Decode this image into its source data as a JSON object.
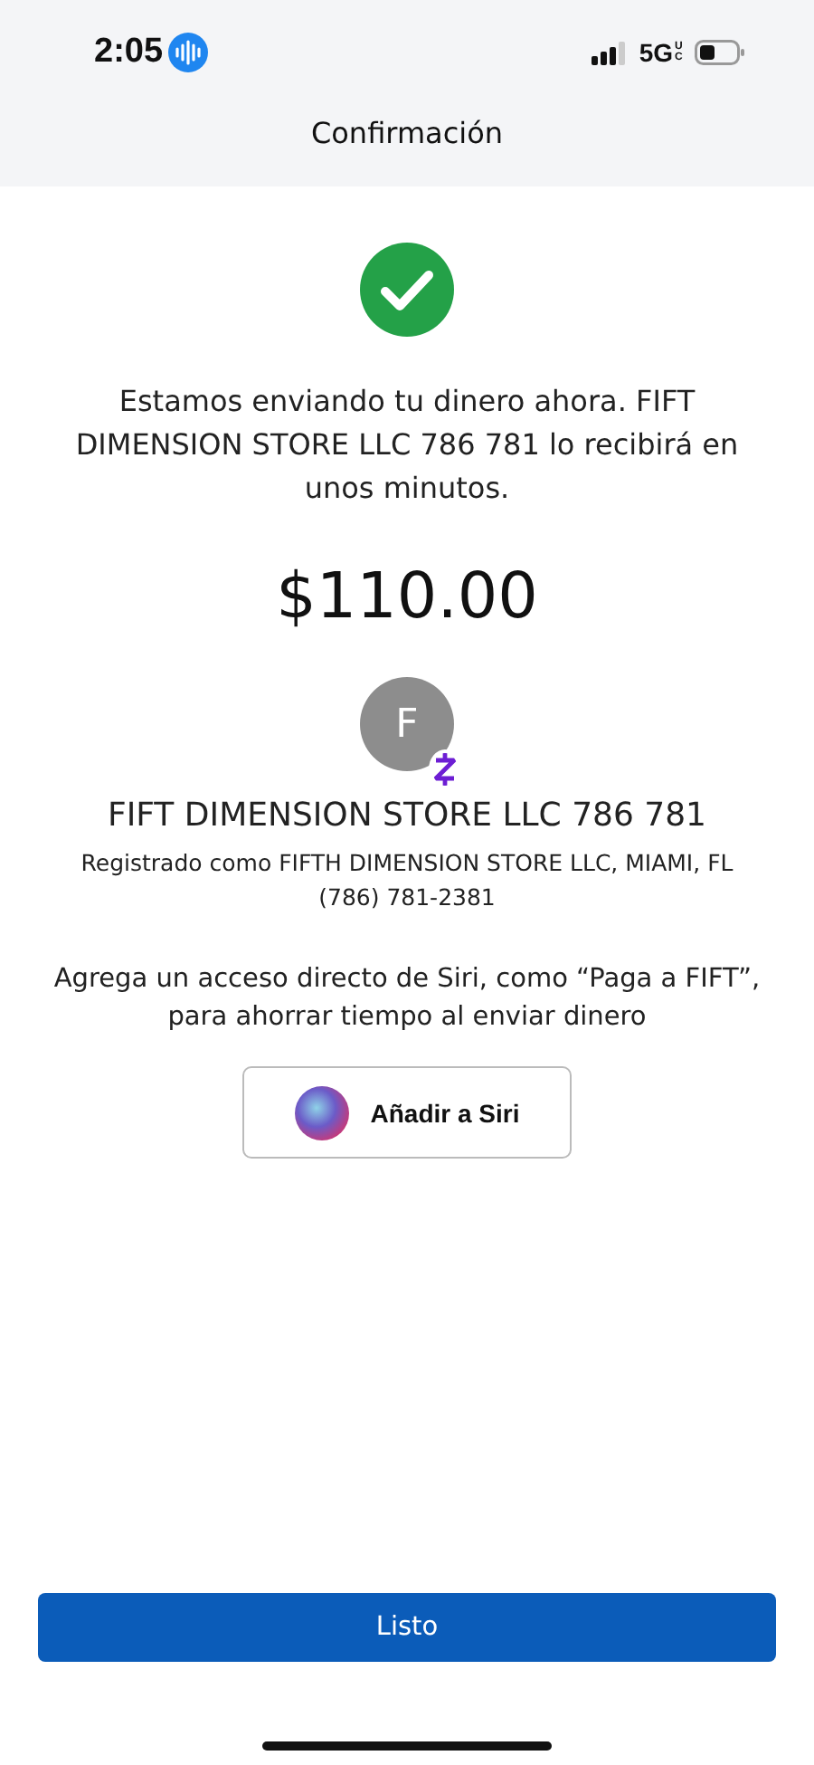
{
  "status_bar": {
    "time": "2:05",
    "network": "5G",
    "network_sub": "UC"
  },
  "header": {
    "title": "Confirmación"
  },
  "message": "Estamos enviando tu dinero ahora. FIFT DIMENSION STORE LLC 786 781 lo recibirá en unos minutos.",
  "amount": "$110.00",
  "recipient": {
    "initial": "F",
    "name": "FIFT DIMENSION STORE LLC 786 781",
    "registered": "Registrado como FIFTH DIMENSION STORE LLC, MIAMI, FL",
    "phone": "(786) 781-2381"
  },
  "siri": {
    "text": "Agrega un acceso directo de Siri, como “Paga a FIFT”, para ahorrar tiempo al enviar dinero",
    "button": "Añadir a Siri"
  },
  "done_button": "Listo"
}
